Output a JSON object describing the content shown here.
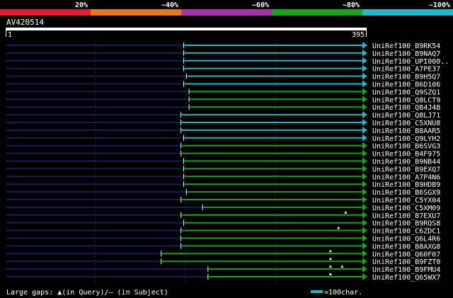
{
  "identity_scale": {
    "labels": [
      "20%",
      "~40%",
      "~60%",
      "~80%",
      "~100%"
    ],
    "colors": [
      "#e01e2f",
      "#e8771f",
      "#a335a8",
      "#19a319",
      "#1eb8c8"
    ]
  },
  "query": {
    "id": "AV420514",
    "start_label": "1",
    "end_label": "395"
  },
  "legend": {
    "gaps_text": "Large gaps: ▲(in Query)/— (in Subject)",
    "scale_text": "=100char.",
    "scale_color": "#1eb8c8"
  },
  "chart_data": {
    "type": "alignment",
    "x_range": [
      1,
      395
    ],
    "hits": [
      {
        "name": "UniRef100_B9RK54",
        "identity": "~100%",
        "start": 198,
        "end": 395,
        "gaps": []
      },
      {
        "name": "UniRef100_B9NAQ7",
        "identity": "~100%",
        "start": 198,
        "end": 395,
        "gaps": []
      },
      {
        "name": "UniRef100_UPI000..",
        "identity": "~100%",
        "start": 198,
        "end": 395,
        "gaps": []
      },
      {
        "name": "UniRef100_A7PE37",
        "identity": "~100%",
        "start": 198,
        "end": 395,
        "gaps": []
      },
      {
        "name": "UniRef100_B9H5Q7",
        "identity": "~100%",
        "start": 201,
        "end": 395,
        "gaps": []
      },
      {
        "name": "UniRef100_B6D106",
        "identity": "~100%",
        "start": 198,
        "end": 395,
        "gaps": []
      },
      {
        "name": "UniRef100_Q9SZQ1",
        "identity": "~80%",
        "start": 204,
        "end": 395,
        "gaps": []
      },
      {
        "name": "UniRef100_Q8LCT9",
        "identity": "~80%",
        "start": 204,
        "end": 395,
        "gaps": []
      },
      {
        "name": "UniRef100_Q84J48",
        "identity": "~80%",
        "start": 204,
        "end": 395,
        "gaps": []
      },
      {
        "name": "UniRef100_Q8LJ71",
        "identity": "~100%",
        "start": 195,
        "end": 395,
        "gaps": []
      },
      {
        "name": "UniRef100_C5XNU8",
        "identity": "~100%",
        "start": 195,
        "end": 395,
        "gaps": []
      },
      {
        "name": "UniRef100_B8AAR5",
        "identity": "~100%",
        "start": 195,
        "end": 395,
        "gaps": []
      },
      {
        "name": "UniRef100_Q9LYH2",
        "identity": "~100%",
        "start": 198,
        "end": 395,
        "gaps": []
      },
      {
        "name": "UniRef100_B6SVG3",
        "identity": "~80%",
        "start": 195,
        "end": 395,
        "gaps": []
      },
      {
        "name": "UniRef100_B4F975",
        "identity": "~80%",
        "start": 195,
        "end": 395,
        "gaps": []
      },
      {
        "name": "UniRef100_B9NB44",
        "identity": "~80%",
        "start": 198,
        "end": 395,
        "gaps": []
      },
      {
        "name": "UniRef100_B9EXQ7",
        "identity": "~80%",
        "start": 198,
        "end": 395,
        "gaps": []
      },
      {
        "name": "UniRef100_A7P4N6",
        "identity": "~80%",
        "start": 198,
        "end": 395,
        "gaps": []
      },
      {
        "name": "UniRef100_B9HDB9",
        "identity": "~80%",
        "start": 198,
        "end": 395,
        "gaps": []
      },
      {
        "name": "UniRef100_B6SGX9",
        "identity": "~80%",
        "start": 201,
        "end": 395,
        "gaps": []
      },
      {
        "name": "UniRef100_C5YX04",
        "identity": "~80%",
        "start": 195,
        "end": 395,
        "gaps": []
      },
      {
        "name": "UniRef100_C5XM09",
        "identity": "~80%",
        "start": 219,
        "end": 395,
        "gaps": []
      },
      {
        "name": "UniRef100_B7EXU7",
        "identity": "~80%",
        "start": 195,
        "end": 395,
        "gaps": [
          {
            "type": "query",
            "pos": 378
          }
        ]
      },
      {
        "name": "UniRef100_B9RQS8",
        "identity": "~80%",
        "start": 198,
        "end": 395,
        "gaps": []
      },
      {
        "name": "UniRef100_C6ZDC1",
        "identity": "~80%",
        "start": 195,
        "end": 395,
        "gaps": [
          {
            "type": "query",
            "pos": 370
          }
        ]
      },
      {
        "name": "UniRef100_Q6L4R6",
        "identity": "~80%",
        "start": 195,
        "end": 395,
        "gaps": []
      },
      {
        "name": "UniRef100_B8AXG8",
        "identity": "~80%",
        "start": 195,
        "end": 395,
        "gaps": []
      },
      {
        "name": "UniRef100_Q60F07",
        "identity": "~80%",
        "start": 173,
        "end": 395,
        "gaps": [
          {
            "type": "query",
            "pos": 361
          }
        ]
      },
      {
        "name": "UniRef100_B9FZT0",
        "identity": "~80%",
        "start": 173,
        "end": 395,
        "gaps": [
          {
            "type": "query",
            "pos": 361
          }
        ]
      },
      {
        "name": "UniRef100_B9FMU4",
        "identity": "~80%",
        "start": 225,
        "end": 395,
        "gaps": [
          {
            "type": "query",
            "pos": 361
          },
          {
            "type": "query",
            "pos": 374
          }
        ]
      },
      {
        "name": "UniRef100_Q65WX7",
        "identity": "~80%",
        "start": 225,
        "end": 395,
        "gaps": [
          {
            "type": "query",
            "pos": 361
          }
        ]
      }
    ]
  }
}
